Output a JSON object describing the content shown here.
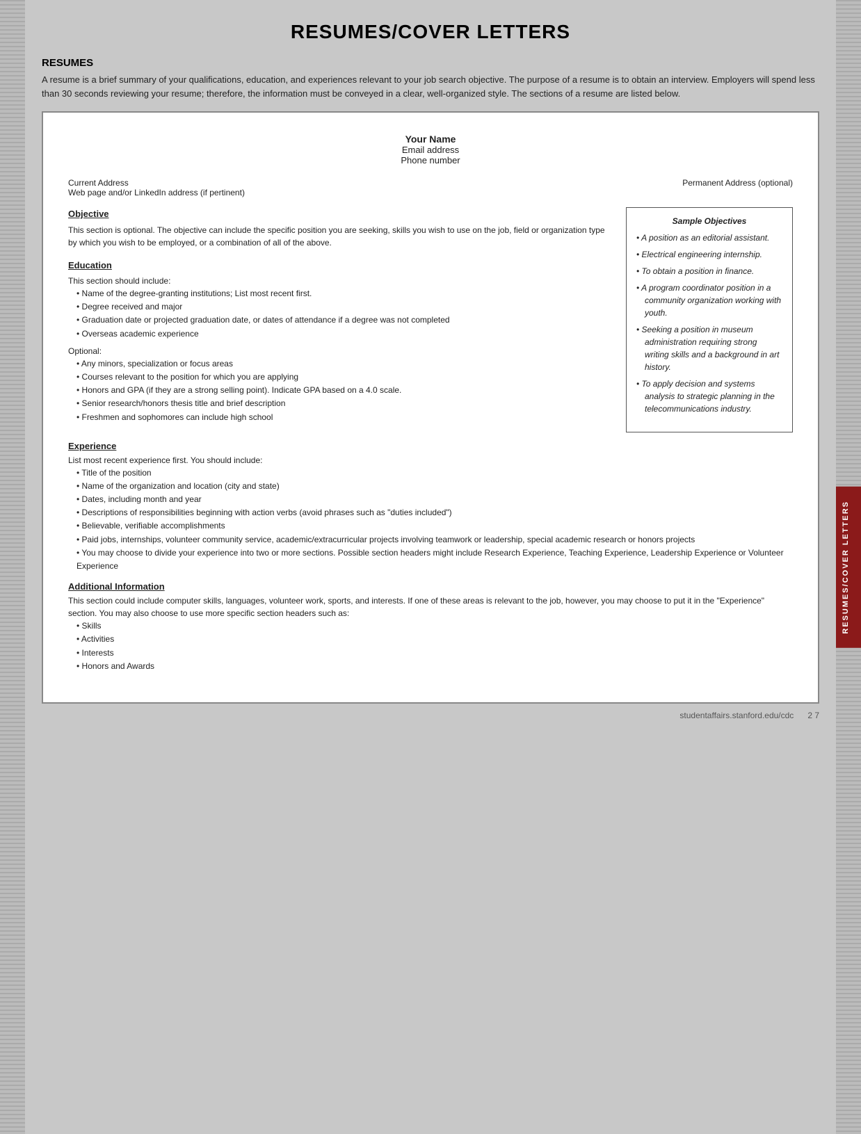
{
  "page": {
    "title": "RESUMES/COVER LETTERS",
    "footer_url": "studentaffairs.stanford.edu/cdc",
    "footer_page": "2 7"
  },
  "side_tab": {
    "label": "RESUMES/COVER LETTERS"
  },
  "resumes_section": {
    "header": "RESUMES",
    "intro": "A resume is a brief summary of your qualifications, education, and experiences relevant to your job search objective. The purpose of a resume is to obtain an interview. Employers will spend less than 30 seconds reviewing your resume; therefore, the information must be conveyed in a clear, well-organized style. The sections of a resume are listed below."
  },
  "resume_doc": {
    "name": "Your Name",
    "email": "Email address",
    "phone": "Phone number",
    "current_address": "Current Address",
    "web_address": "Web page and/or LinkedIn address (if pertinent)",
    "permanent_address": "Permanent Address (optional)"
  },
  "objective_section": {
    "title": "Objective",
    "text": "This section is optional. The objective can include the specific position you are seeking, skills you wish to use on the job, field or organization type by which you wish to be employed, or a combination of all of the above."
  },
  "sample_objectives": {
    "title": "Sample Objectives",
    "items": [
      "A position as an editorial assistant.",
      "Electrical engineering internship.",
      "To obtain a position in finance.",
      "A program coordinator position in a community organization working with youth.",
      "Seeking a position in museum administration requiring strong writing skills and a background in art history.",
      "To apply decision and systems analysis to strategic planning in the telecommunications industry."
    ]
  },
  "education_section": {
    "title": "Education",
    "intro": "This section should include:",
    "required_bullets": [
      "Name of the degree-granting institutions; List most recent first.",
      "Degree received and major",
      "Graduation date or projected graduation date, or dates of attendance if a degree was not completed",
      "Overseas academic experience"
    ],
    "optional_label": "Optional:",
    "optional_bullets": [
      "Any minors, specialization or focus areas",
      "Courses relevant to the position for which you are applying",
      "Honors and GPA (if they are a strong selling point). Indicate GPA based on a 4.0 scale.",
      "Senior research/honors thesis title and brief description",
      "Freshmen and sophomores can include high school"
    ]
  },
  "experience_section": {
    "title": "Experience",
    "intro": "List most recent experience first. You should include:",
    "bullets": [
      "Title of the position",
      "Name of the organization and location (city and state)",
      "Dates, including month and year",
      "Descriptions of responsibilities beginning with action verbs (avoid phrases such as \"duties included\")",
      "Believable, verifiable accomplishments",
      "Paid jobs, internships, volunteer community service, academic/extracurricular projects involving teamwork or leadership, special academic research or honors projects",
      "You may choose to divide your experience into two or more sections. Possible section headers might include Research Experience, Teaching Experience, Leadership Experience or Volunteer Experience"
    ]
  },
  "additional_section": {
    "title": "Additional Information",
    "intro": "This section could include computer skills, languages, volunteer work, sports, and interests. If one of these areas is relevant to the job, however, you may choose to put it in the \"Experience\" section. You may also choose to use more specific section headers such as:",
    "bullets": [
      "Skills",
      "Activities",
      "Interests",
      "Honors and Awards"
    ]
  }
}
